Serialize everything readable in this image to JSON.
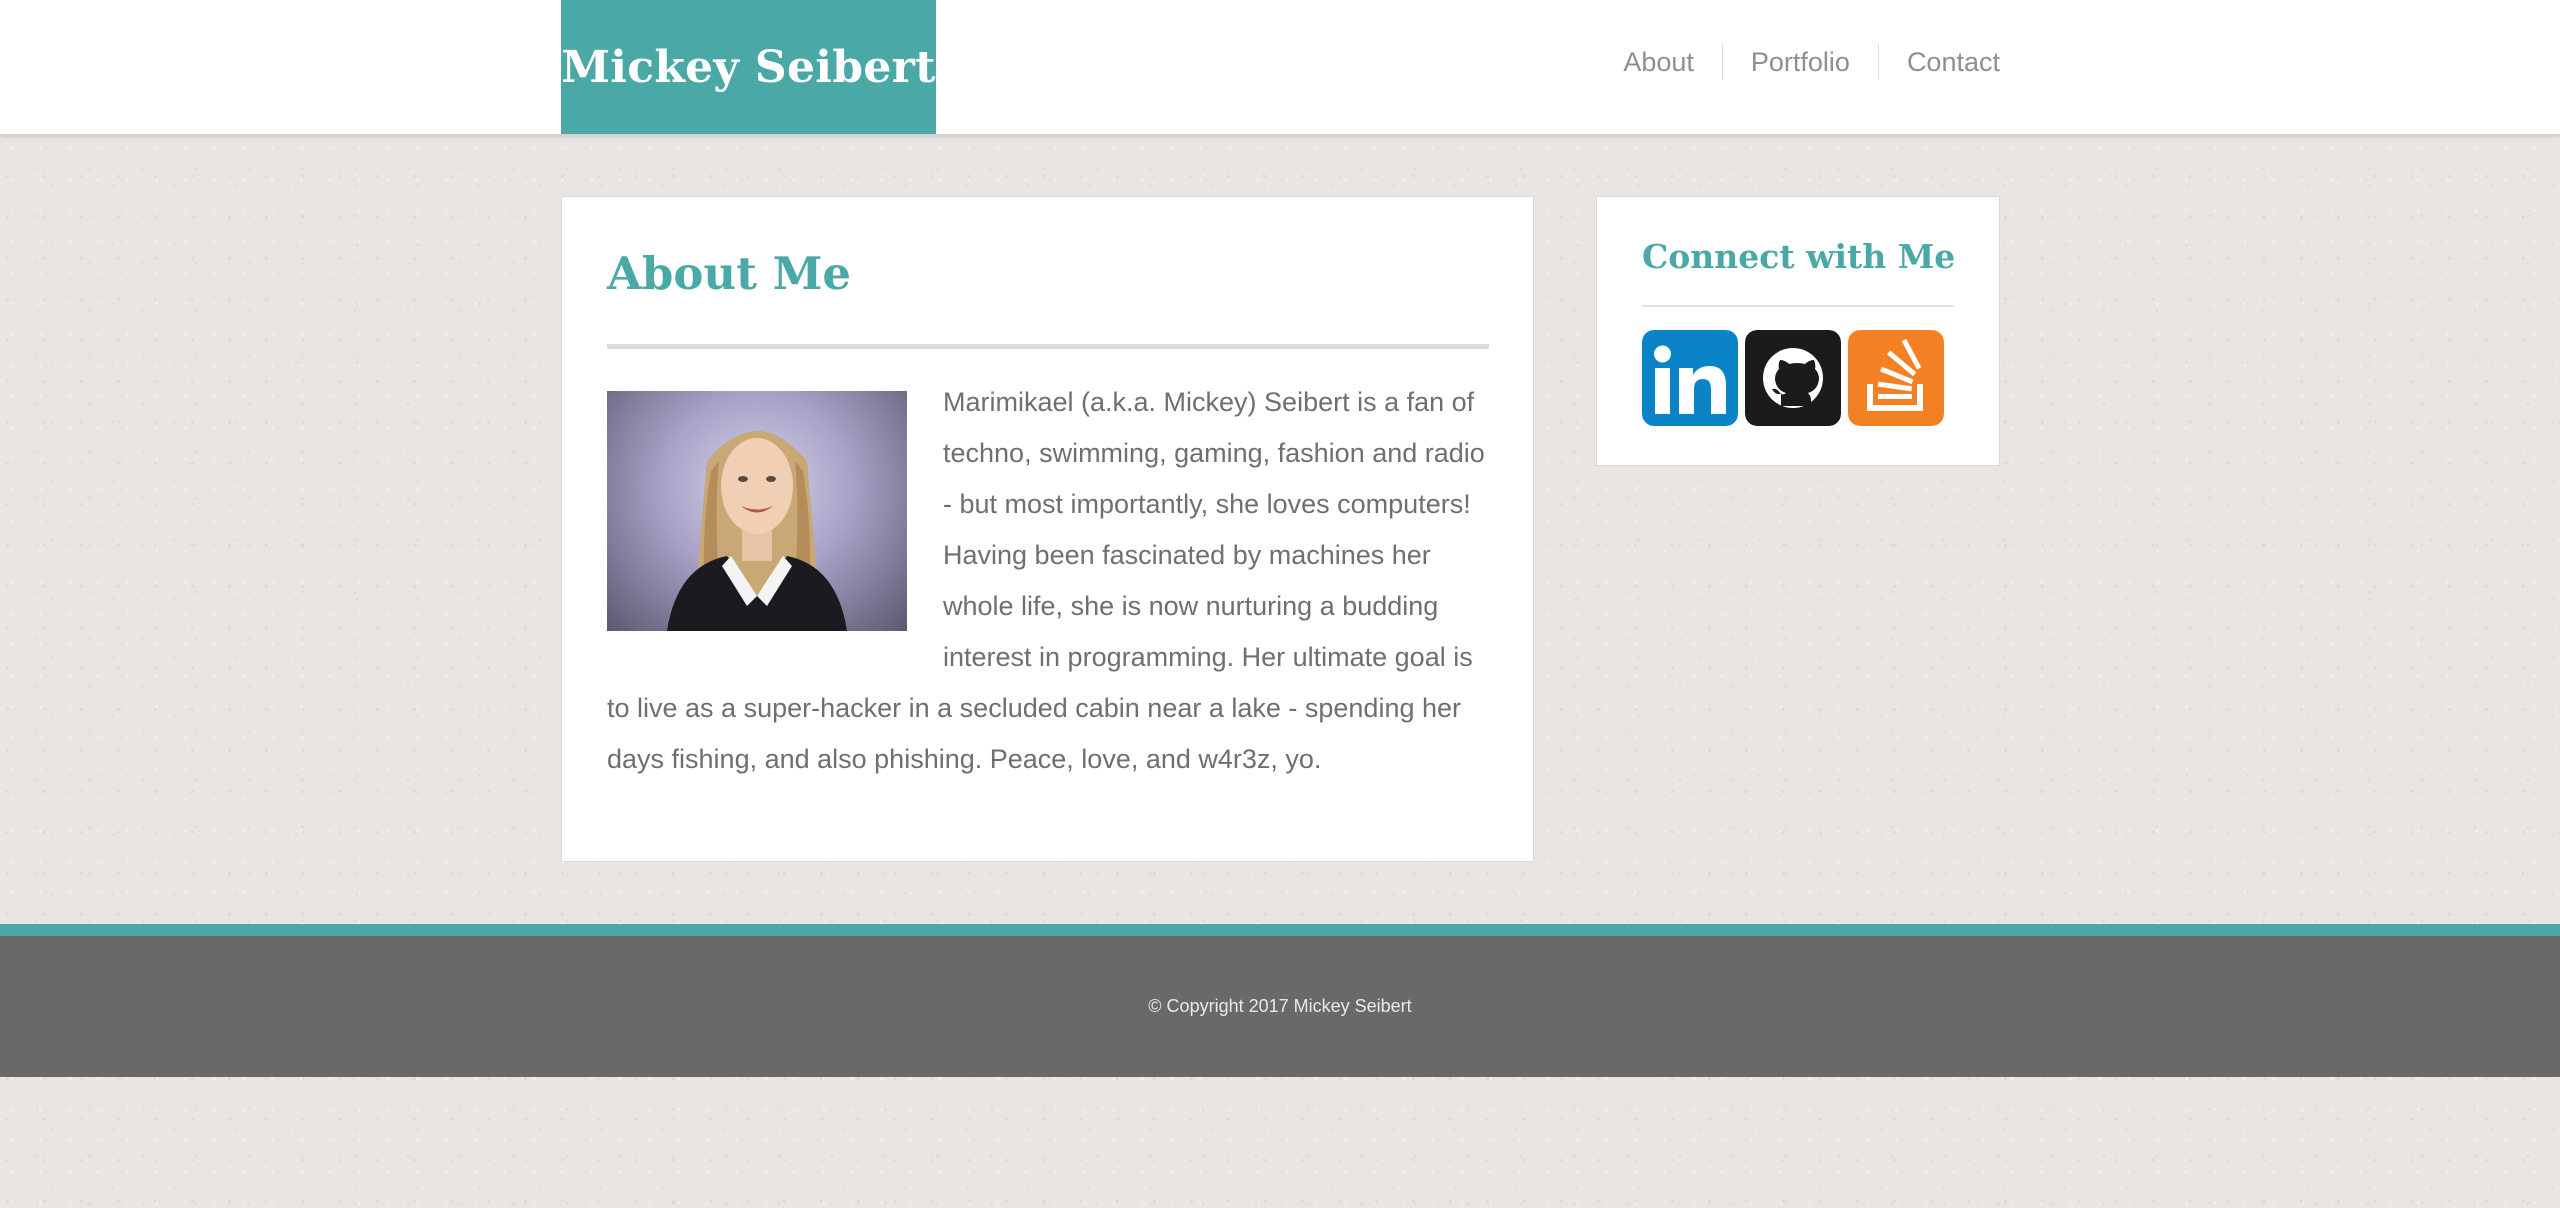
{
  "header": {
    "brand": "Mickey Seibert",
    "nav": [
      {
        "label": "About"
      },
      {
        "label": "Portfolio"
      },
      {
        "label": "Contact"
      }
    ]
  },
  "main": {
    "title": "About Me",
    "body": "Marimikael (a.k.a. Mickey) Seibert is a fan of techno, swimming, gaming, fashion and radio - but most importantly, she loves computers! Having been fascinated by machines her whole life, she is now nurturing a budding interest in programming. Her ultimate goal is to live as a super-hacker in a secluded cabin near a lake - spending her days fishing, and also phishing. Peace, love, and w4r3z, yo."
  },
  "sidebar": {
    "title": "Connect with Me",
    "social": [
      {
        "name": "linkedin",
        "icon": "linkedin-icon",
        "text": "in",
        "color": "#0a84c6"
      },
      {
        "name": "github",
        "icon": "github-icon",
        "color": "#1b1b1b"
      },
      {
        "name": "stackoverflow",
        "icon": "stackoverflow-icon",
        "color": "#f48024"
      }
    ]
  },
  "footer": {
    "copyright": "© Copyright 2017 Mickey Seibert"
  },
  "colors": {
    "accent": "#4aa8a6",
    "footer_bg": "#696969",
    "text": "#6f6f6f"
  }
}
